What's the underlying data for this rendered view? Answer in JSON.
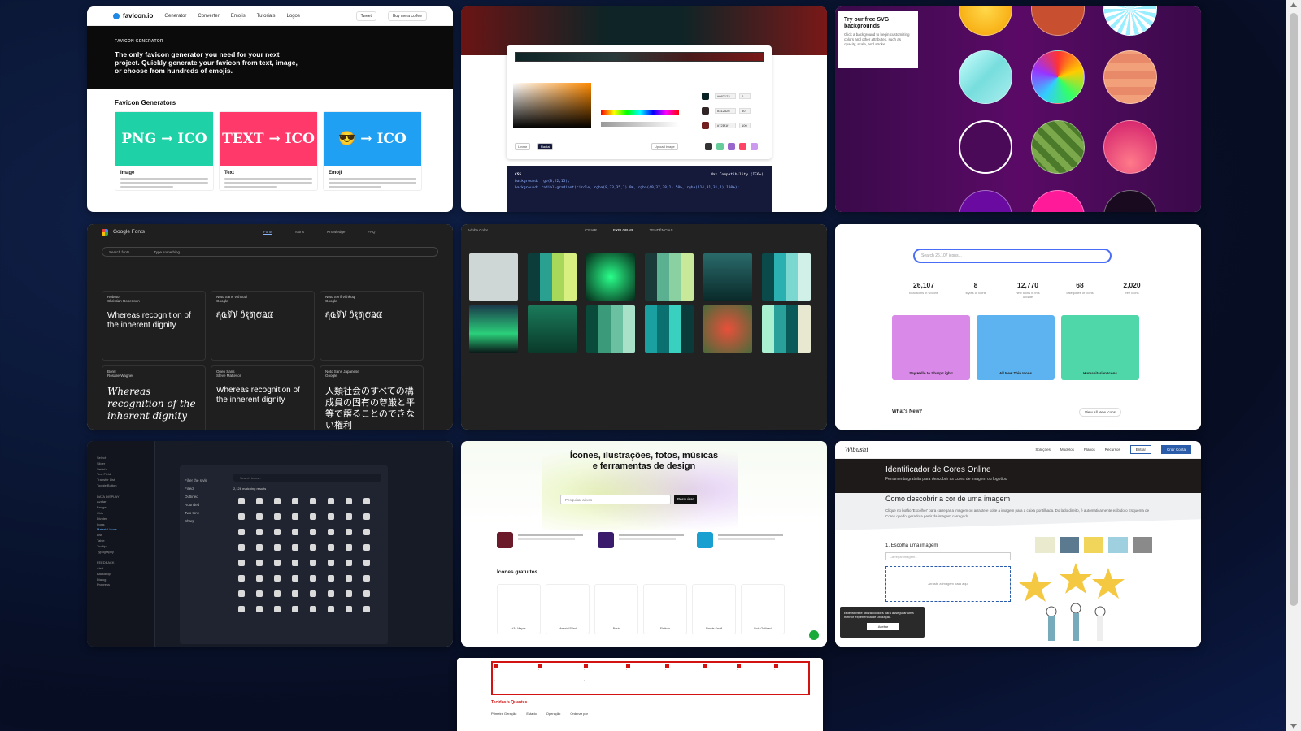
{
  "favicon": {
    "logo": "favicon.io",
    "nav": [
      "Generator",
      "Converter",
      "Emojis",
      "Tutorials",
      "Logos"
    ],
    "tweet": "Tweet",
    "coffee": "Buy me a coffee",
    "kicker": "FAVICON GENERATOR",
    "headline": "The only favicon generator you need for your next project. Quickly generate your favicon from text, image, or choose from hundreds of emojis.",
    "section_title": "Favicon Generators",
    "tiles": [
      {
        "title": "PNG → ICO",
        "label": "Image",
        "color": "#1fd1a7"
      },
      {
        "title": "TEXT → ICO",
        "label": "Text",
        "color": "#ff3a6b"
      },
      {
        "title": "😎 → ICO",
        "label": "Emoji",
        "color": "#1fa0f2"
      }
    ]
  },
  "gradient": {
    "css_label": "CSS",
    "max_compat": "Max Compatibility (IE6+)",
    "code_line1": "background: rgb(8,22,15);",
    "code_line2": "background: radial-gradient(circle, rgba(8,33,35,1) 0%, rgba(49,37,38,1) 50%, rgba(114,31,31,1) 100%);",
    "linear": "Linear",
    "radial": "Radial",
    "upload": "Upload image",
    "stops": [
      "#082123",
      "#312526",
      "#721f1f"
    ],
    "stop_positions": [
      "0",
      "50",
      "100"
    ],
    "palette": [
      "#333333",
      "#66cc99",
      "#9966cc",
      "#ff4466",
      "#cc99ee"
    ]
  },
  "svgbg": {
    "title": "Try our free SVG backgrounds",
    "text": "Click a background to begin customizing colors and other attributes, such as opacity, scale, and stroke."
  },
  "gfonts": {
    "brand": "Google Fonts",
    "tabs": [
      "Fonts",
      "Icons",
      "Knowledge",
      "FAQ"
    ],
    "search": "Search fonts",
    "type_something": "Type something",
    "fonts": [
      {
        "name": "Roboto",
        "author": "Christian Robertson",
        "sample": "Whereas recognition of the inherent dignity"
      },
      {
        "name": "Noto Sans Vithkuqi",
        "author": "Google",
        "sample": "𐖀𐖁𐖂𐖃 𐖄𐖅𐖆𐖇𐖈𐖉"
      },
      {
        "name": "Noto Serif Vithkuqi",
        "author": "Google",
        "sample": "𐖀𐖁𐖂𐖃 𐖄𐖅𐖆𐖇𐖈𐖉"
      },
      {
        "name": "Borel",
        "author": "Rosalie Wagner",
        "sample": "Whereas recognition of the inherent dignity"
      },
      {
        "name": "Open Sans",
        "author": "Steve Matteson",
        "sample": "Whereas recognition of the inherent dignity"
      },
      {
        "name": "Noto Sans Japanese",
        "author": "Google",
        "sample": "人類社会のすべての構成員の固有の尊厳と平等で譲ることのできない権利"
      }
    ]
  },
  "adobe": {
    "brand": "Adobe Color",
    "nav": [
      "CRIAR",
      "EXPLORAR",
      "TENDÊNCIAS"
    ]
  },
  "flaticon": {
    "search": "Search 26,107 icons...",
    "stats": [
      {
        "num": "26,107",
        "label": "total icons in UIcons"
      },
      {
        "num": "8",
        "label": "styles of icons"
      },
      {
        "num": "12,770",
        "label": "new icons in this update"
      },
      {
        "num": "68",
        "label": "categories of icons"
      },
      {
        "num": "2,020",
        "label": "free icons"
      }
    ],
    "cards": [
      {
        "label": "Say Hello to Sharp Light!",
        "color": "#d98ae8"
      },
      {
        "label": "All New Thin Icons",
        "color": "#5cb3ef"
      },
      {
        "label": "Humanitarian Icons",
        "color": "#4fd6a9"
      }
    ],
    "whats_new": "What's New?",
    "view_all": "View All New Icons"
  },
  "docs": {
    "filter_title": "Filter the style",
    "filters": [
      "Filled",
      "Outlined",
      "Rounded",
      "Two tone",
      "Sharp"
    ],
    "search": "Search icons...",
    "results": "2,126 matching results"
  },
  "freepik": {
    "title": "Ícones, ilustrações, fotos, músicas e ferramentas de design",
    "search_placeholder": "Pesquisar ativos",
    "search_btn": "Pesquisar",
    "section": "Ícones gratuitos",
    "packs": [
      "+34 Mayas",
      "Material Filled",
      "Basic",
      "Flaticon",
      "Simple Small",
      "Dots Outlined"
    ]
  },
  "colorid": {
    "logo": "Wibushi",
    "nav": [
      "Soluções",
      "Modelos",
      "Planos",
      "Recursos"
    ],
    "login": "Entrar",
    "signup": "Criar Conta",
    "title": "Identificador de Cores Online",
    "subtitle": "Ferramenta gratuita para descobrir as cores de imagem ou logotipo",
    "h2": "Como descobrir a cor de uma imagem",
    "p": "Clique no botão 'Escolher' para carregar a imagem ou arraste e solte a imagem para a caixa pontilhada. Do lado direito, é automaticamente exibido o Esquema de Cores que foi gerado a partir da imagem carregada.",
    "step": "1. Escolha uma imagem",
    "file_placeholder": "Carregar imagem...",
    "drop": "Arraste a imagem para aqui",
    "swatches": [
      "#eaeacf",
      "#5b7a90",
      "#f0d55a",
      "#9fd0e0",
      "#8a8a8a"
    ],
    "cookie": "Este website utiliza cookies para assegurar uma melhor experiência de utilização.",
    "cookie_btn": "Aceitar"
  },
  "quantas": {
    "crumb": "Tecidos > Quantas",
    "form_labels": [
      "Primeira Geração",
      "Estado",
      "Operação",
      "Ordenar por"
    ]
  }
}
